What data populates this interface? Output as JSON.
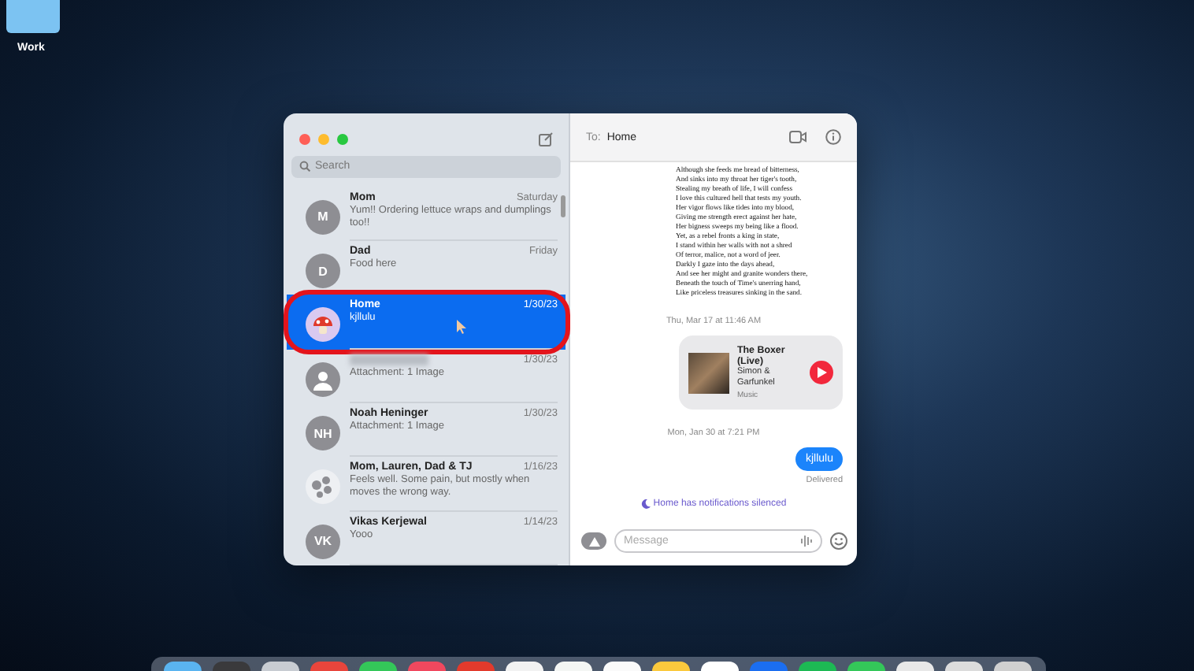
{
  "desktop": {
    "folder_label": "Work"
  },
  "sidebar": {
    "search": {
      "placeholder": "Search"
    },
    "conversations": [
      {
        "name": "Mom",
        "preview": "Yum!! Ordering lettuce wraps and dumplings too!!",
        "date": "Saturday",
        "avatar": {
          "kind": "initials",
          "text": "M"
        },
        "selected": false
      },
      {
        "name": "Dad",
        "preview": "Food here",
        "date": "Friday",
        "avatar": {
          "kind": "initials",
          "text": "D"
        },
        "selected": false
      },
      {
        "name": "Home",
        "preview": "kjllulu",
        "date": "1/30/23",
        "avatar": {
          "kind": "mushroom"
        },
        "selected": true
      },
      {
        "preview": "Attachment: 1 Image",
        "date": "1/30/23",
        "avatar": {
          "kind": "person"
        },
        "selected": false
      },
      {
        "name": "Noah Heninger",
        "preview": "Attachment: 1 Image",
        "date": "1/30/23",
        "avatar": {
          "kind": "initials",
          "text": "NH"
        },
        "selected": false
      },
      {
        "name": "Mom, Lauren, Dad & TJ",
        "preview": "Feels well.  Some pain,  but mostly when moves the wrong way.",
        "date": "1/16/23",
        "avatar": {
          "kind": "group"
        },
        "selected": false
      },
      {
        "name": "Vikas Kerjewal",
        "preview": "Yooo",
        "date": "1/14/23",
        "avatar": {
          "kind": "initials",
          "text": "VK"
        },
        "selected": false
      }
    ]
  },
  "chat": {
    "to_label": "To:",
    "recipient": "Home",
    "messages": [
      {
        "kind": "poem",
        "lines": [
          "Although she feeds me bread of bitterness,",
          "And sinks into my throat her tiger's tooth,",
          "Stealing my breath of life, I will confess",
          "I love this cultured hell that tests my youth.",
          "Her vigor flows like tides into my blood,",
          "Giving me strength erect against her hate,",
          "Her bigness sweeps my being like a flood.",
          "Yet, as a rebel fronts a king in state,",
          "I stand within her walls with not a shred",
          "Of terror, malice, not a word of jeer.",
          "Darkly I gaze into the days ahead,",
          "And see her might and granite wonders there,",
          "Beneath the touch of Time's unerring hand,",
          "Like priceless treasures sinking in the sand."
        ]
      },
      {
        "kind": "timestamp",
        "text": "Thu, Mar 17 at 11:46 AM"
      },
      {
        "kind": "music",
        "title": "The Boxer (Live)",
        "artist": "Simon & Garfunkel",
        "source": "Music"
      },
      {
        "kind": "timestamp",
        "text": "Mon, Jan 30 at 7:21 PM"
      },
      {
        "kind": "sent",
        "text": "kjllulu"
      },
      {
        "kind": "status",
        "text": "Delivered"
      },
      {
        "kind": "notice",
        "text": "Home has notifications silenced"
      }
    ],
    "composer": {
      "placeholder": "Message"
    }
  },
  "dock": {
    "apps": [
      {
        "color": "#5ab4f0"
      },
      {
        "color": "#3a3a3c"
      },
      {
        "color": "#c8ccd2"
      },
      {
        "color": "#e8453c"
      },
      {
        "color": "#34c759"
      },
      {
        "color": "#f0485e"
      },
      {
        "color": "#e23a2c"
      },
      {
        "color": "#f2f2f2"
      },
      {
        "color": "#f4f6f4"
      },
      {
        "color": "#fafafa"
      },
      {
        "color": "#fbc93d"
      },
      {
        "color": "#ffffff"
      },
      {
        "color": "#1b6ef0"
      },
      {
        "color": "#1db954"
      },
      {
        "color": "#34c759"
      },
      {
        "color": "#e8e8e8"
      },
      {
        "color": "#dcdcdc"
      },
      {
        "color": "#d0d0d0"
      }
    ]
  }
}
